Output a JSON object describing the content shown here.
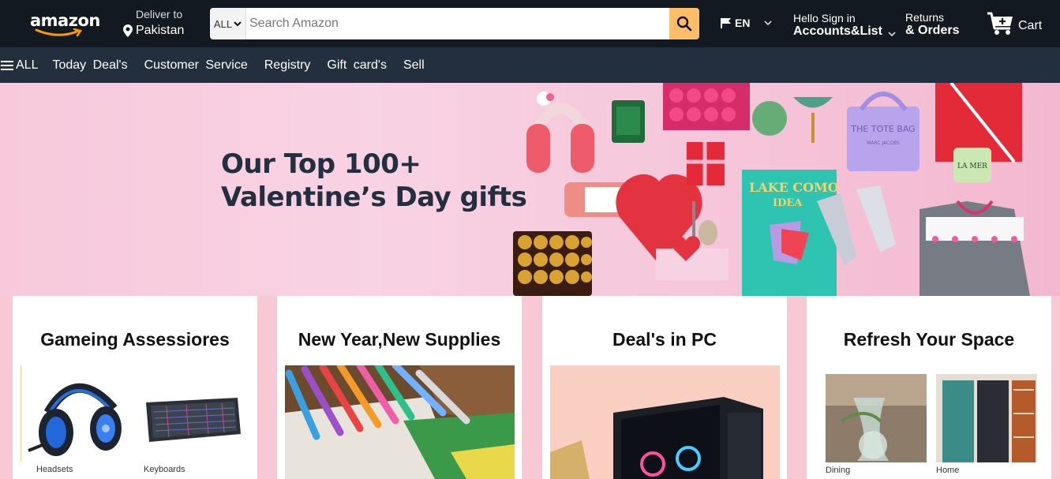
{
  "header": {
    "logo_text": "amazon",
    "deliver_label": "Deliver to",
    "deliver_location": "Pakistan",
    "search_category": "ALL",
    "search_placeholder": "Search Amazon",
    "language": "EN",
    "account_greeting": "Hello Sign in",
    "account_label": "Accounts&List",
    "returns_label": "Returns",
    "orders_label": "& Orders",
    "cart_label": "Cart"
  },
  "subnav": {
    "all_label": "ALL",
    "items": [
      "Today  Deal's",
      "Customer  Service",
      "Registry",
      "Gift  card's",
      "Sell"
    ]
  },
  "hero": {
    "line1": "Our Top 100+",
    "line2": "Valentine’s Day gifts",
    "art_texts": {
      "tote": "THE TOTE BAG",
      "tote_brand": "MARC JACOBS",
      "book": "LAKE COMO",
      "book2": "IDEA",
      "cream": "LA MER"
    }
  },
  "cards": [
    {
      "title": "Gameing Assessiores",
      "captions": [
        "Headsets",
        "Keyboards"
      ]
    },
    {
      "title": "New Year,New Supplies"
    },
    {
      "title": "Deal's in PC"
    },
    {
      "title": "Refresh Your Space",
      "captions": [
        "Dining",
        "Home"
      ]
    }
  ],
  "colors": {
    "nav_dark": "#131921",
    "subnav": "#232f3e",
    "search_button": "#febd69",
    "page_bg": "#f6c9d4"
  }
}
